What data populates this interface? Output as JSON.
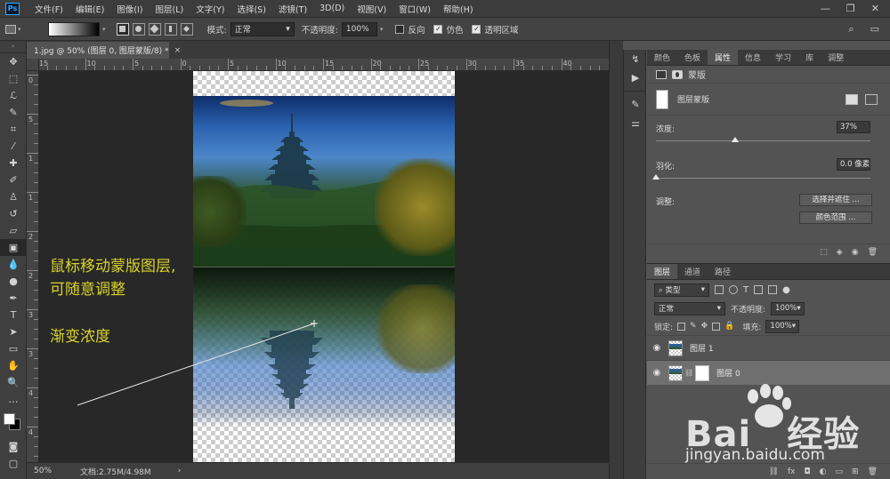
{
  "app": {
    "logo": "Ps",
    "menu": [
      "文件(F)",
      "编辑(E)",
      "图像(I)",
      "图层(L)",
      "文字(Y)",
      "选择(S)",
      "滤镜(T)",
      "3D(D)",
      "视图(V)",
      "窗口(W)",
      "帮助(H)"
    ]
  },
  "options": {
    "mode_label": "模式:",
    "mode_value": "正常",
    "opacity_label": "不透明度:",
    "opacity_value": "100%",
    "reverse_label": "反向",
    "dither_label": "仿色",
    "transparency_label": "透明区域",
    "reverse_checked": false,
    "dither_checked": true,
    "transparency_checked": true
  },
  "document": {
    "tab_title": "1.jpg @ 50% (图层 0, 图层蒙版/8) *",
    "zoom": "50%",
    "doc_info": "文档:2.75M/4.98M"
  },
  "ruler": {
    "top_labels": [
      "15",
      "10",
      "5",
      "0",
      "5",
      "10",
      "15",
      "20",
      "25",
      "30",
      "35",
      "40"
    ],
    "left_labels": [
      "0",
      "5",
      "1",
      "1",
      "2",
      "2",
      "3",
      "3",
      "4",
      "4"
    ]
  },
  "canvas": {
    "annotation_line1": "鼠标移动蒙版图层,",
    "annotation_line2": "可随意调整",
    "annotation_line3": "渐变浓度"
  },
  "properties": {
    "tabs": [
      "颜色",
      "色板",
      "属性",
      "信息",
      "学习",
      "库",
      "调整"
    ],
    "active_tab": "属性",
    "header_label": "蒙版",
    "mask_label": "图层蒙版",
    "density_label": "浓度:",
    "density_value": "37%",
    "density_level": 0.37,
    "feather_label": "羽化:",
    "feather_value": "0.0 像素",
    "feather_level": 0,
    "adjust_label": "调整:",
    "select_mask_button": "选择并遮住 ...",
    "color_range_button": "颜色范围 ..."
  },
  "layers": {
    "tabs": [
      "图层",
      "通道",
      "路径"
    ],
    "active_tab": "图层",
    "filter_type": "类型",
    "blend_mode": "正常",
    "opacity_label": "不透明度:",
    "opacity_value": "100%",
    "lock_label": "锁定:",
    "fill_label": "填充:",
    "fill_value": "100%",
    "items": [
      {
        "name": "图层 1",
        "selected": false,
        "has_mask": false
      },
      {
        "name": "图层 0",
        "selected": true,
        "has_mask": true
      }
    ]
  },
  "watermark": {
    "brand": "Bai",
    "brand_cn": "经验",
    "url": "jingyan.baidu.com"
  },
  "colors": {
    "accent": "#31a8ff",
    "annotation_text": "#d9d22a",
    "foreground": "#ffffff",
    "background": "#000000"
  }
}
